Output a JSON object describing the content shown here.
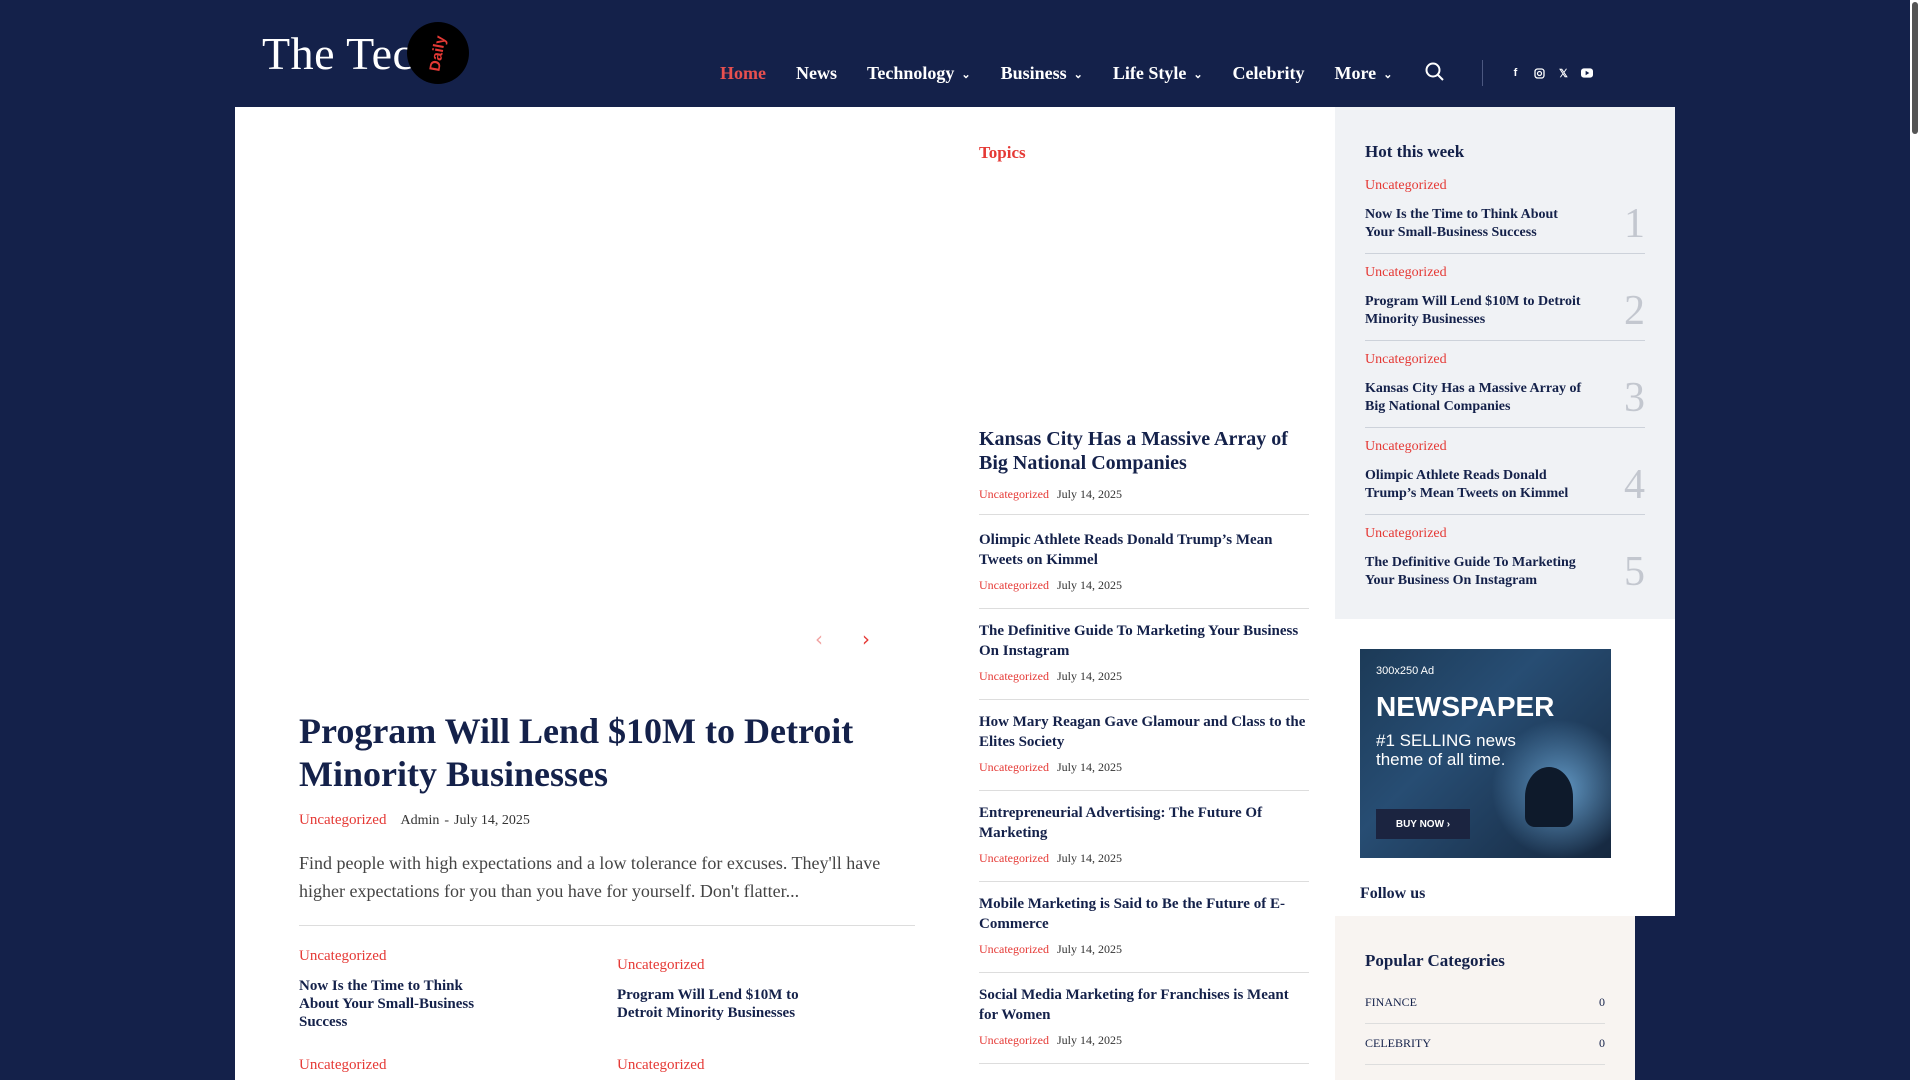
{
  "header": {
    "logo_text": "The Tech",
    "logo_badge": "Daily",
    "nav": [
      {
        "label": "Home",
        "active": true,
        "dropdown": false
      },
      {
        "label": "News",
        "active": false,
        "dropdown": false
      },
      {
        "label": "Technology",
        "active": false,
        "dropdown": true
      },
      {
        "label": "Business",
        "active": false,
        "dropdown": true
      },
      {
        "label": "Life Style",
        "active": false,
        "dropdown": true
      },
      {
        "label": "Celebrity",
        "active": false,
        "dropdown": false
      },
      {
        "label": "More",
        "active": false,
        "dropdown": true
      }
    ],
    "search_icon": "search-icon",
    "social": [
      "facebook-icon",
      "instagram-icon",
      "x-icon",
      "youtube-icon"
    ]
  },
  "colors": {
    "navy": "#14214a",
    "accent": "#e53935",
    "active_nav": "#e8504f"
  },
  "featured": {
    "title": "Program Will Lend $10M to Detroit Minority Businesses",
    "category": "Uncategorized",
    "author": "Admin",
    "separator": "-",
    "date": "July 14, 2025",
    "excerpt": "Find people with high expectations and a low tolerance for excuses. They'll have higher expectations for you than you have for yourself. Don't flatter..."
  },
  "small_cards": [
    {
      "category": "Uncategorized",
      "title": "Now Is the Time to Think About Your Small-Business Success"
    },
    {
      "category": "Uncategorized",
      "title": "Program Will Lend $10M to Detroit Minority Businesses"
    },
    {
      "category": "Uncategorized",
      "title": ""
    },
    {
      "category": "Uncategorized",
      "title": ""
    }
  ],
  "topics": {
    "label": "Topics",
    "lead": {
      "title": "Kansas City Has a Massive Array of Big National Companies",
      "category": "Uncategorized",
      "date": "July 14, 2025"
    },
    "items": [
      {
        "title": "Olimpic Athlete Reads Donald Trump’s Mean Tweets on Kimmel",
        "category": "Uncategorized",
        "date": "July 14, 2025"
      },
      {
        "title": "The Definitive Guide To Marketing Your Business On Instagram",
        "category": "Uncategorized",
        "date": "July 14, 2025"
      },
      {
        "title": "How Mary Reagan Gave Glamour and Class to the Elites Society",
        "category": "Uncategorized",
        "date": "July 14, 2025"
      },
      {
        "title": "Entrepreneurial Advertising: The Future Of Marketing",
        "category": "Uncategorized",
        "date": "July 14, 2025"
      },
      {
        "title": "Mobile Marketing is Said to Be the Future of E-Commerce",
        "category": "Uncategorized",
        "date": "July 14, 2025"
      },
      {
        "title": "Social Media Marketing for Franchises is Meant for Women",
        "category": "Uncategorized",
        "date": "July 14, 2025"
      }
    ]
  },
  "hot": {
    "title": "Hot this week",
    "items": [
      {
        "num": "1",
        "category": "Uncategorized",
        "title": "Now Is the Time to Think About Your Small-Business Success"
      },
      {
        "num": "2",
        "category": "Uncategorized",
        "title": "Program Will Lend $10M to Detroit Minority Businesses"
      },
      {
        "num": "3",
        "category": "Uncategorized",
        "title": "Kansas City Has a Massive Array of Big National Companies"
      },
      {
        "num": "4",
        "category": "Uncategorized",
        "title": "Olimpic Athlete Reads Donald Trump’s Mean Tweets on Kimmel"
      },
      {
        "num": "5",
        "category": "Uncategorized",
        "title": "The Definitive Guide To Marketing Your Business On Instagram"
      }
    ]
  },
  "ad": {
    "label": "300x250 Ad",
    "headline": "NEWSPAPER",
    "sub": "#1 SELLING news theme of all time.",
    "button": "BUY NOW ›"
  },
  "follow": "Follow us",
  "popular": {
    "title": "Popular Categories",
    "items": [
      {
        "name": "FINANCE",
        "count": "0"
      },
      {
        "name": "CELEBRITY",
        "count": "0"
      }
    ]
  }
}
